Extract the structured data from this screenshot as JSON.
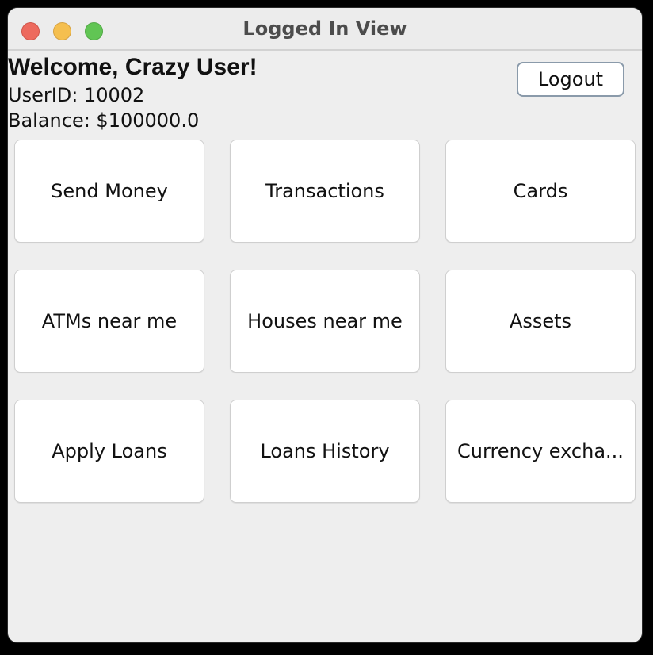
{
  "window": {
    "title": "Logged In View"
  },
  "header": {
    "welcome": "Welcome, Crazy User!",
    "userid": "UserID: 10002",
    "balance": "Balance: $100000.0",
    "logout_label": "Logout"
  },
  "actions": [
    {
      "label": "Send Money"
    },
    {
      "label": "Transactions"
    },
    {
      "label": "Cards"
    },
    {
      "label": "ATMs near me"
    },
    {
      "label": "Houses near me"
    },
    {
      "label": "Assets"
    },
    {
      "label": "Apply Loans"
    },
    {
      "label": "Loans History"
    },
    {
      "label": "Currency excha..."
    }
  ],
  "colors": {
    "close": "#ed6a5e",
    "minimize": "#f5bf4f",
    "maximize": "#61c554",
    "window_bg": "#eeeeee",
    "button_bg": "#ffffff"
  }
}
